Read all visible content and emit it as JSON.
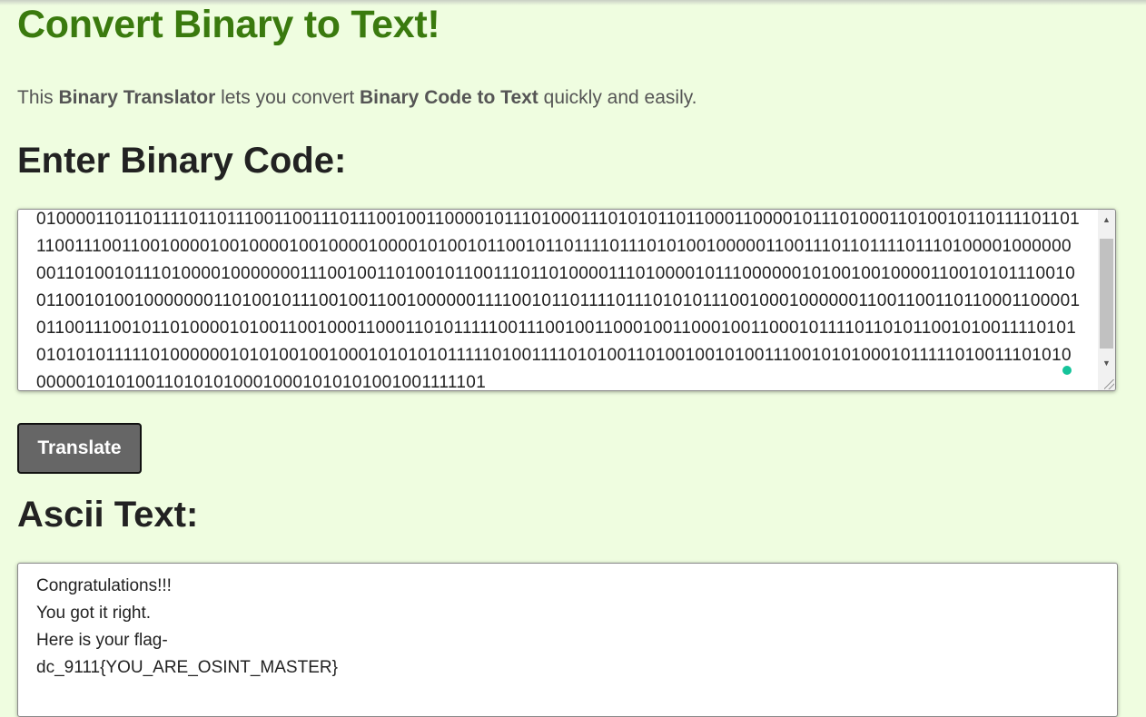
{
  "header": {
    "title": "Convert Binary to Text!"
  },
  "intro": {
    "part1": "This ",
    "bold1": "Binary Translator",
    "part2": " lets you convert ",
    "bold2": "Binary Code to Text",
    "part3": " quickly and easily."
  },
  "input_section": {
    "heading": "Enter Binary Code:",
    "binary_value": "01000011011011110110111001100111011100100110000101110100011101010110110001100001011101000110100101101111011011100111001100100001001000010010000100001010010110010110111101110101001000001100111011011110111010000100000000110100101110100001000000011100100110100101100111011010000111010000101110000001010010010000110010101110010011001010010000000110100101110010011001000000111100101101111011101010111001000100000011001100110110001100001011001110010110100001010011001000110001101011111001110010011000100110001001100010111101101011001010011110101010101011111010000001010100100100010101010111110100111101010011010010010100111001010100010111110100111010100000010101001101010100010001010101001001111101"
  },
  "translate_button": {
    "label": "Translate"
  },
  "output_section": {
    "heading": "Ascii Text:",
    "lines": [
      "Congratulations!!!",
      "You got it right.",
      "Here is your flag-",
      "dc_9111{YOU_ARE_OSINT_MASTER}"
    ]
  },
  "colors": {
    "background": "#effde0",
    "title": "#3a7a0e",
    "button": "#666666",
    "grammar_dot": "#15c39a"
  },
  "icons": {
    "scroll_up": "scroll-up-arrow-icon",
    "scroll_down": "scroll-down-arrow-icon",
    "resize": "resize-grip-icon"
  }
}
